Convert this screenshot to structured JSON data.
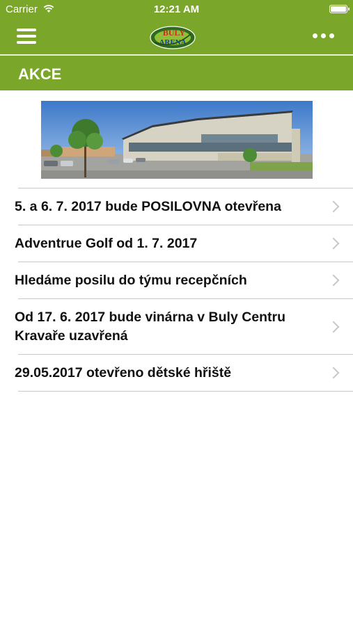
{
  "status_bar": {
    "carrier": "Carrier",
    "time": "12:21 AM"
  },
  "nav": {
    "logo_top": "BULY",
    "logo_bottom": "ARENA",
    "icons": {
      "menu": "hamburger-icon",
      "more": "more-dots-icon"
    }
  },
  "section": {
    "title": "AKCE"
  },
  "hero": {
    "description": "photo of arena building"
  },
  "list": {
    "items": [
      {
        "label": "5. a 6. 7. 2017 bude POSILOVNA otevřena"
      },
      {
        "label": "Adventrue Golf od 1. 7. 2017"
      },
      {
        "label": "Hledáme posilu do týmu recepčních"
      },
      {
        "label": "Od 17. 6. 2017 bude vinárna v Buly Centru Kravaře uzavřená"
      },
      {
        "label": "29.05.2017 otevřeno dětské hřiště"
      }
    ]
  },
  "colors": {
    "brand_green": "#7aa62a",
    "separator": "#c8c8c8",
    "chevron": "#c7c7cc"
  }
}
